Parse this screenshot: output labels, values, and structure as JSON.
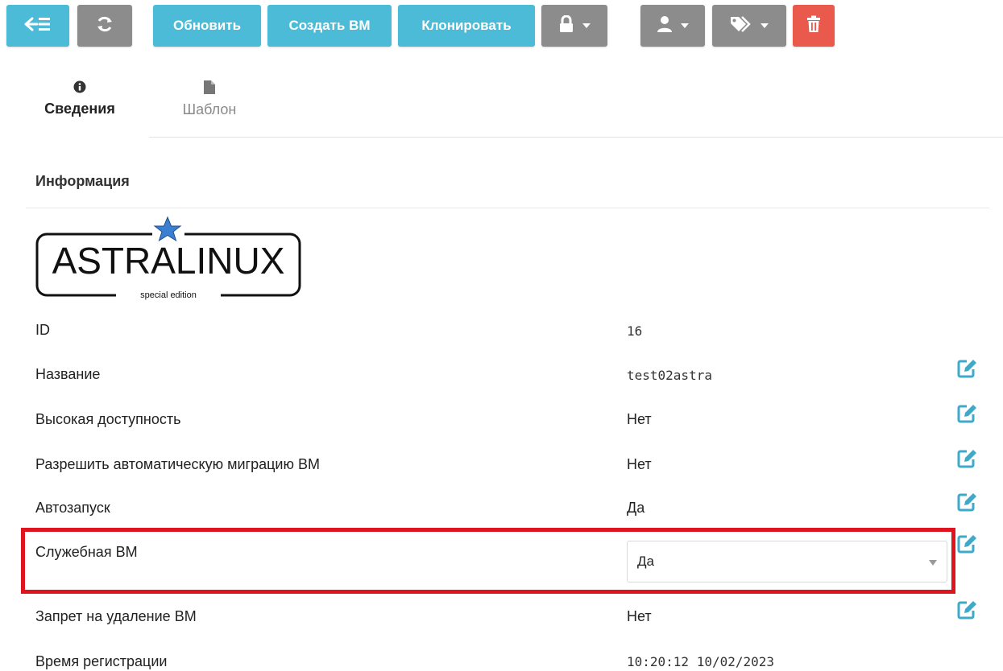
{
  "toolbar": {
    "refresh_label": "Обновить",
    "create_vm_label": "Создать ВМ",
    "clone_label": "Клонировать"
  },
  "tabs": [
    {
      "label": "Сведения",
      "active": true
    },
    {
      "label": "Шаблон",
      "active": false
    }
  ],
  "section": {
    "title": "Информация"
  },
  "logo": {
    "brand": "ASTRALINUX",
    "tagline": "special edition"
  },
  "rows": {
    "id": {
      "label": "ID",
      "value": "16"
    },
    "name": {
      "label": "Название",
      "value": "test02astra"
    },
    "ha": {
      "label": "Высокая доступность",
      "value": "Нет"
    },
    "migration": {
      "label": "Разрешить автоматическую миграцию ВМ",
      "value": "Нет"
    },
    "autostart": {
      "label": "Автозапуск",
      "value": "Да"
    },
    "service_vm": {
      "label": "Служебная ВМ",
      "value": "Да"
    },
    "delete_protect": {
      "label": "Запрет на удаление ВМ",
      "value": "Нет"
    },
    "reg_time": {
      "label": "Время регистрации",
      "value": "10:20:12 10/02/2023"
    }
  },
  "colors": {
    "teal": "#4bbbd8",
    "gray": "#8c8c8c",
    "red": "#ea5a4c",
    "edit_icon": "#3fa9c9",
    "highlight": "#e0141e"
  },
  "icons": [
    "back-list-icon",
    "sync-icon",
    "lock-icon",
    "user-icon",
    "tag-icon",
    "trash-icon",
    "info-icon",
    "file-icon",
    "edit-icon",
    "caret-down-icon"
  ]
}
